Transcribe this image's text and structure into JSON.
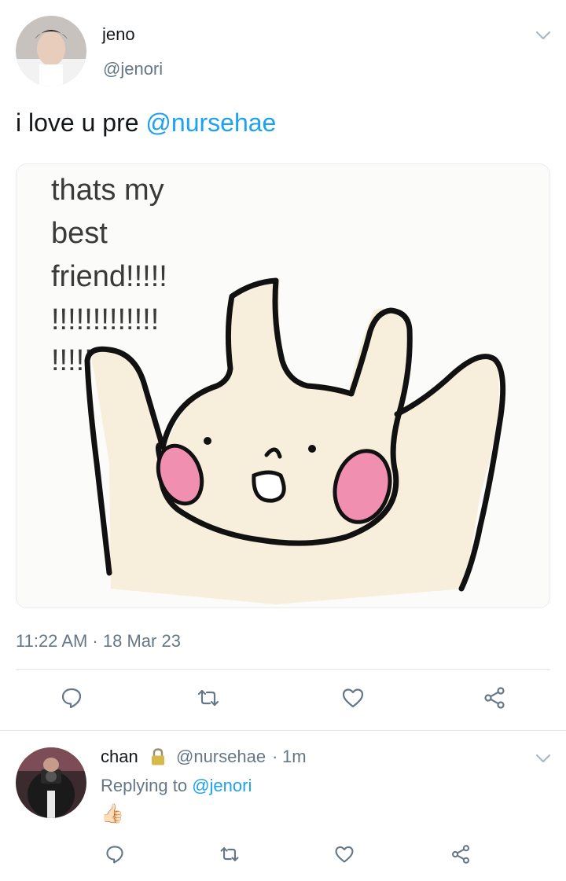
{
  "tweet": {
    "author_name": "jeno",
    "author_handle": "@jenori",
    "text_before": "i love u pre ",
    "text_mention": "@nursehae",
    "timestamp": "11:22 AM · 18 Mar 23",
    "media": {
      "meme_lines": [
        "thats my",
        "best",
        "friend!!!!!",
        "!!!!!!!!!!!!!",
        "!!!!!!"
      ]
    },
    "actions": [
      "reply-icon",
      "retweet-icon",
      "like-icon",
      "share-icon"
    ]
  },
  "reply": {
    "author_name": "chan",
    "author_handle": "@nursehae",
    "separator": "·",
    "time": "1m",
    "replying_label": "Replying to ",
    "replying_to": "@jenori",
    "text": "👍🏻",
    "actions": [
      "reply-icon",
      "retweet-icon",
      "like-icon",
      "share-icon"
    ]
  },
  "colors": {
    "accent": "#1da1f2",
    "secondary_text": "#657786",
    "divider": "#e1e8ed",
    "icon": "#657786"
  }
}
